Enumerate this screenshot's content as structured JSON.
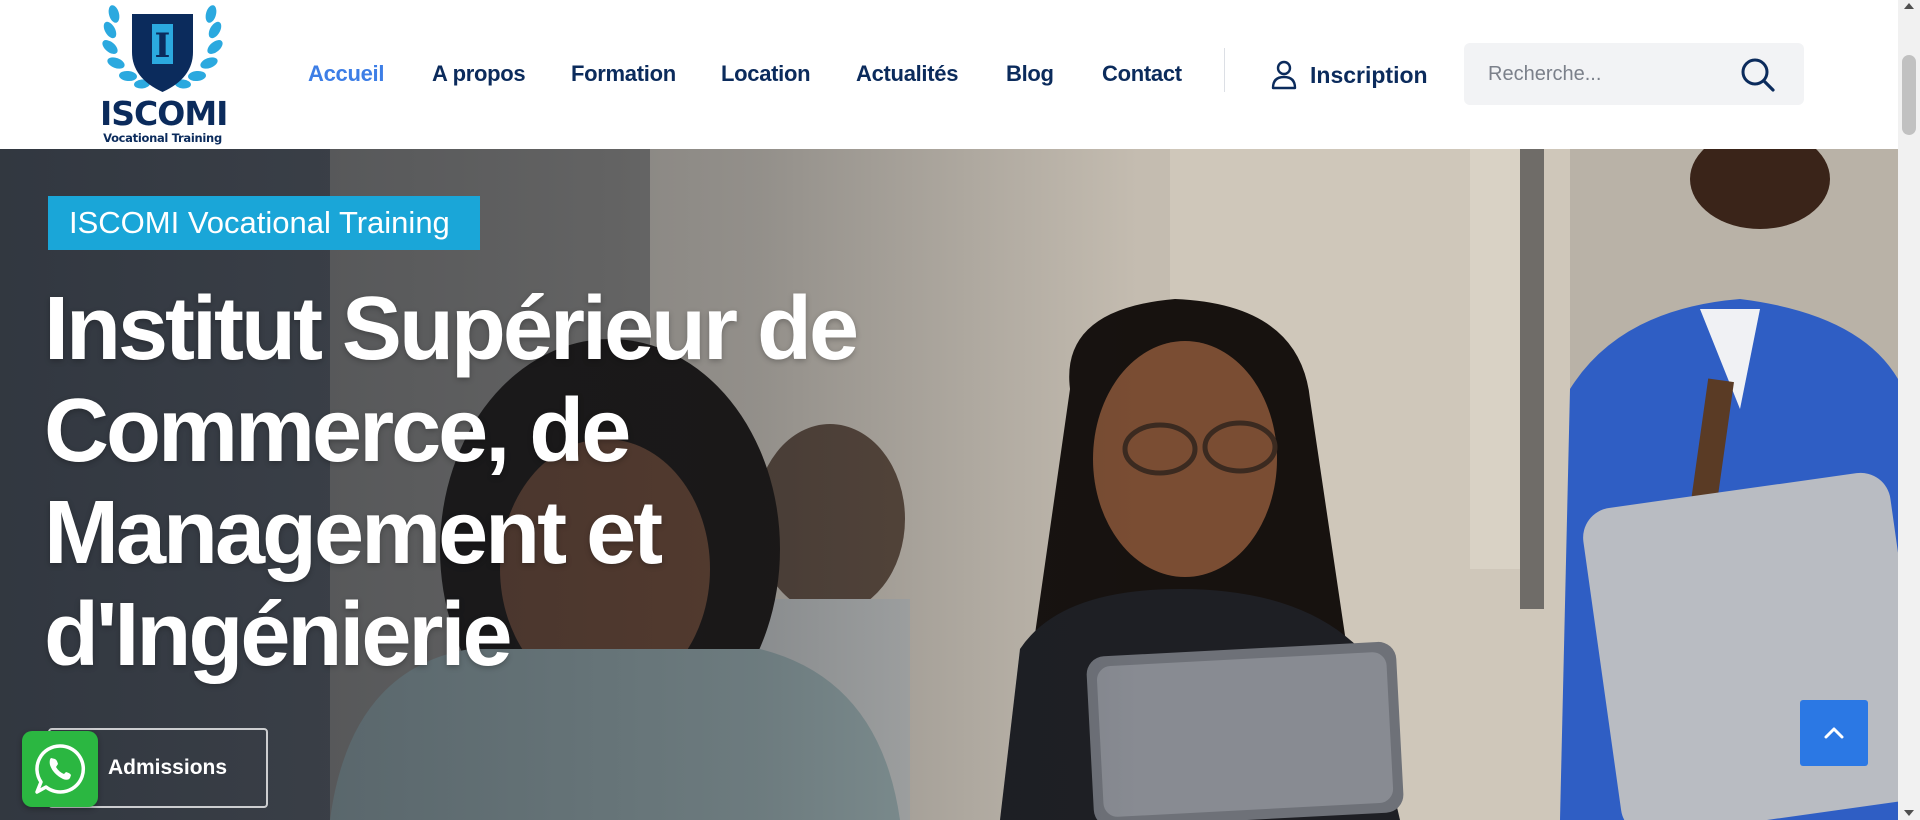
{
  "brand": {
    "name": "ISCOMI",
    "tagline": "Vocational Training",
    "logo_letter": "I",
    "colors": {
      "navy": "#0b2b5c",
      "laurel": "#2ba9df"
    }
  },
  "nav": {
    "items": [
      {
        "label": "Accueil",
        "active": true
      },
      {
        "label": "A propos",
        "active": false
      },
      {
        "label": "Formation",
        "active": false
      },
      {
        "label": "Location",
        "active": false
      },
      {
        "label": "Actualités",
        "active": false
      },
      {
        "label": "Blog",
        "active": false
      },
      {
        "label": "Contact",
        "active": false
      }
    ],
    "signup_label": "Inscription",
    "signup_icon": "user-icon",
    "active_color": "#3d7ee6",
    "text_color": "#0b2b5c"
  },
  "search": {
    "placeholder": "Recherche...",
    "value": "",
    "icon": "search-icon"
  },
  "hero": {
    "badge": "ISCOMI Vocational Training",
    "badge_color": "#1aa6d8",
    "title_lines": [
      "Institut Supérieur de",
      "Commerce, de",
      "Management et",
      "d'Ingénierie"
    ],
    "cta_label": "Admissions"
  },
  "floating": {
    "whatsapp_icon": "whatsapp-icon",
    "whatsapp_color": "#2bb741",
    "scroll_top_icon": "chevron-up-icon",
    "scroll_top_color": "#2b78e4"
  }
}
